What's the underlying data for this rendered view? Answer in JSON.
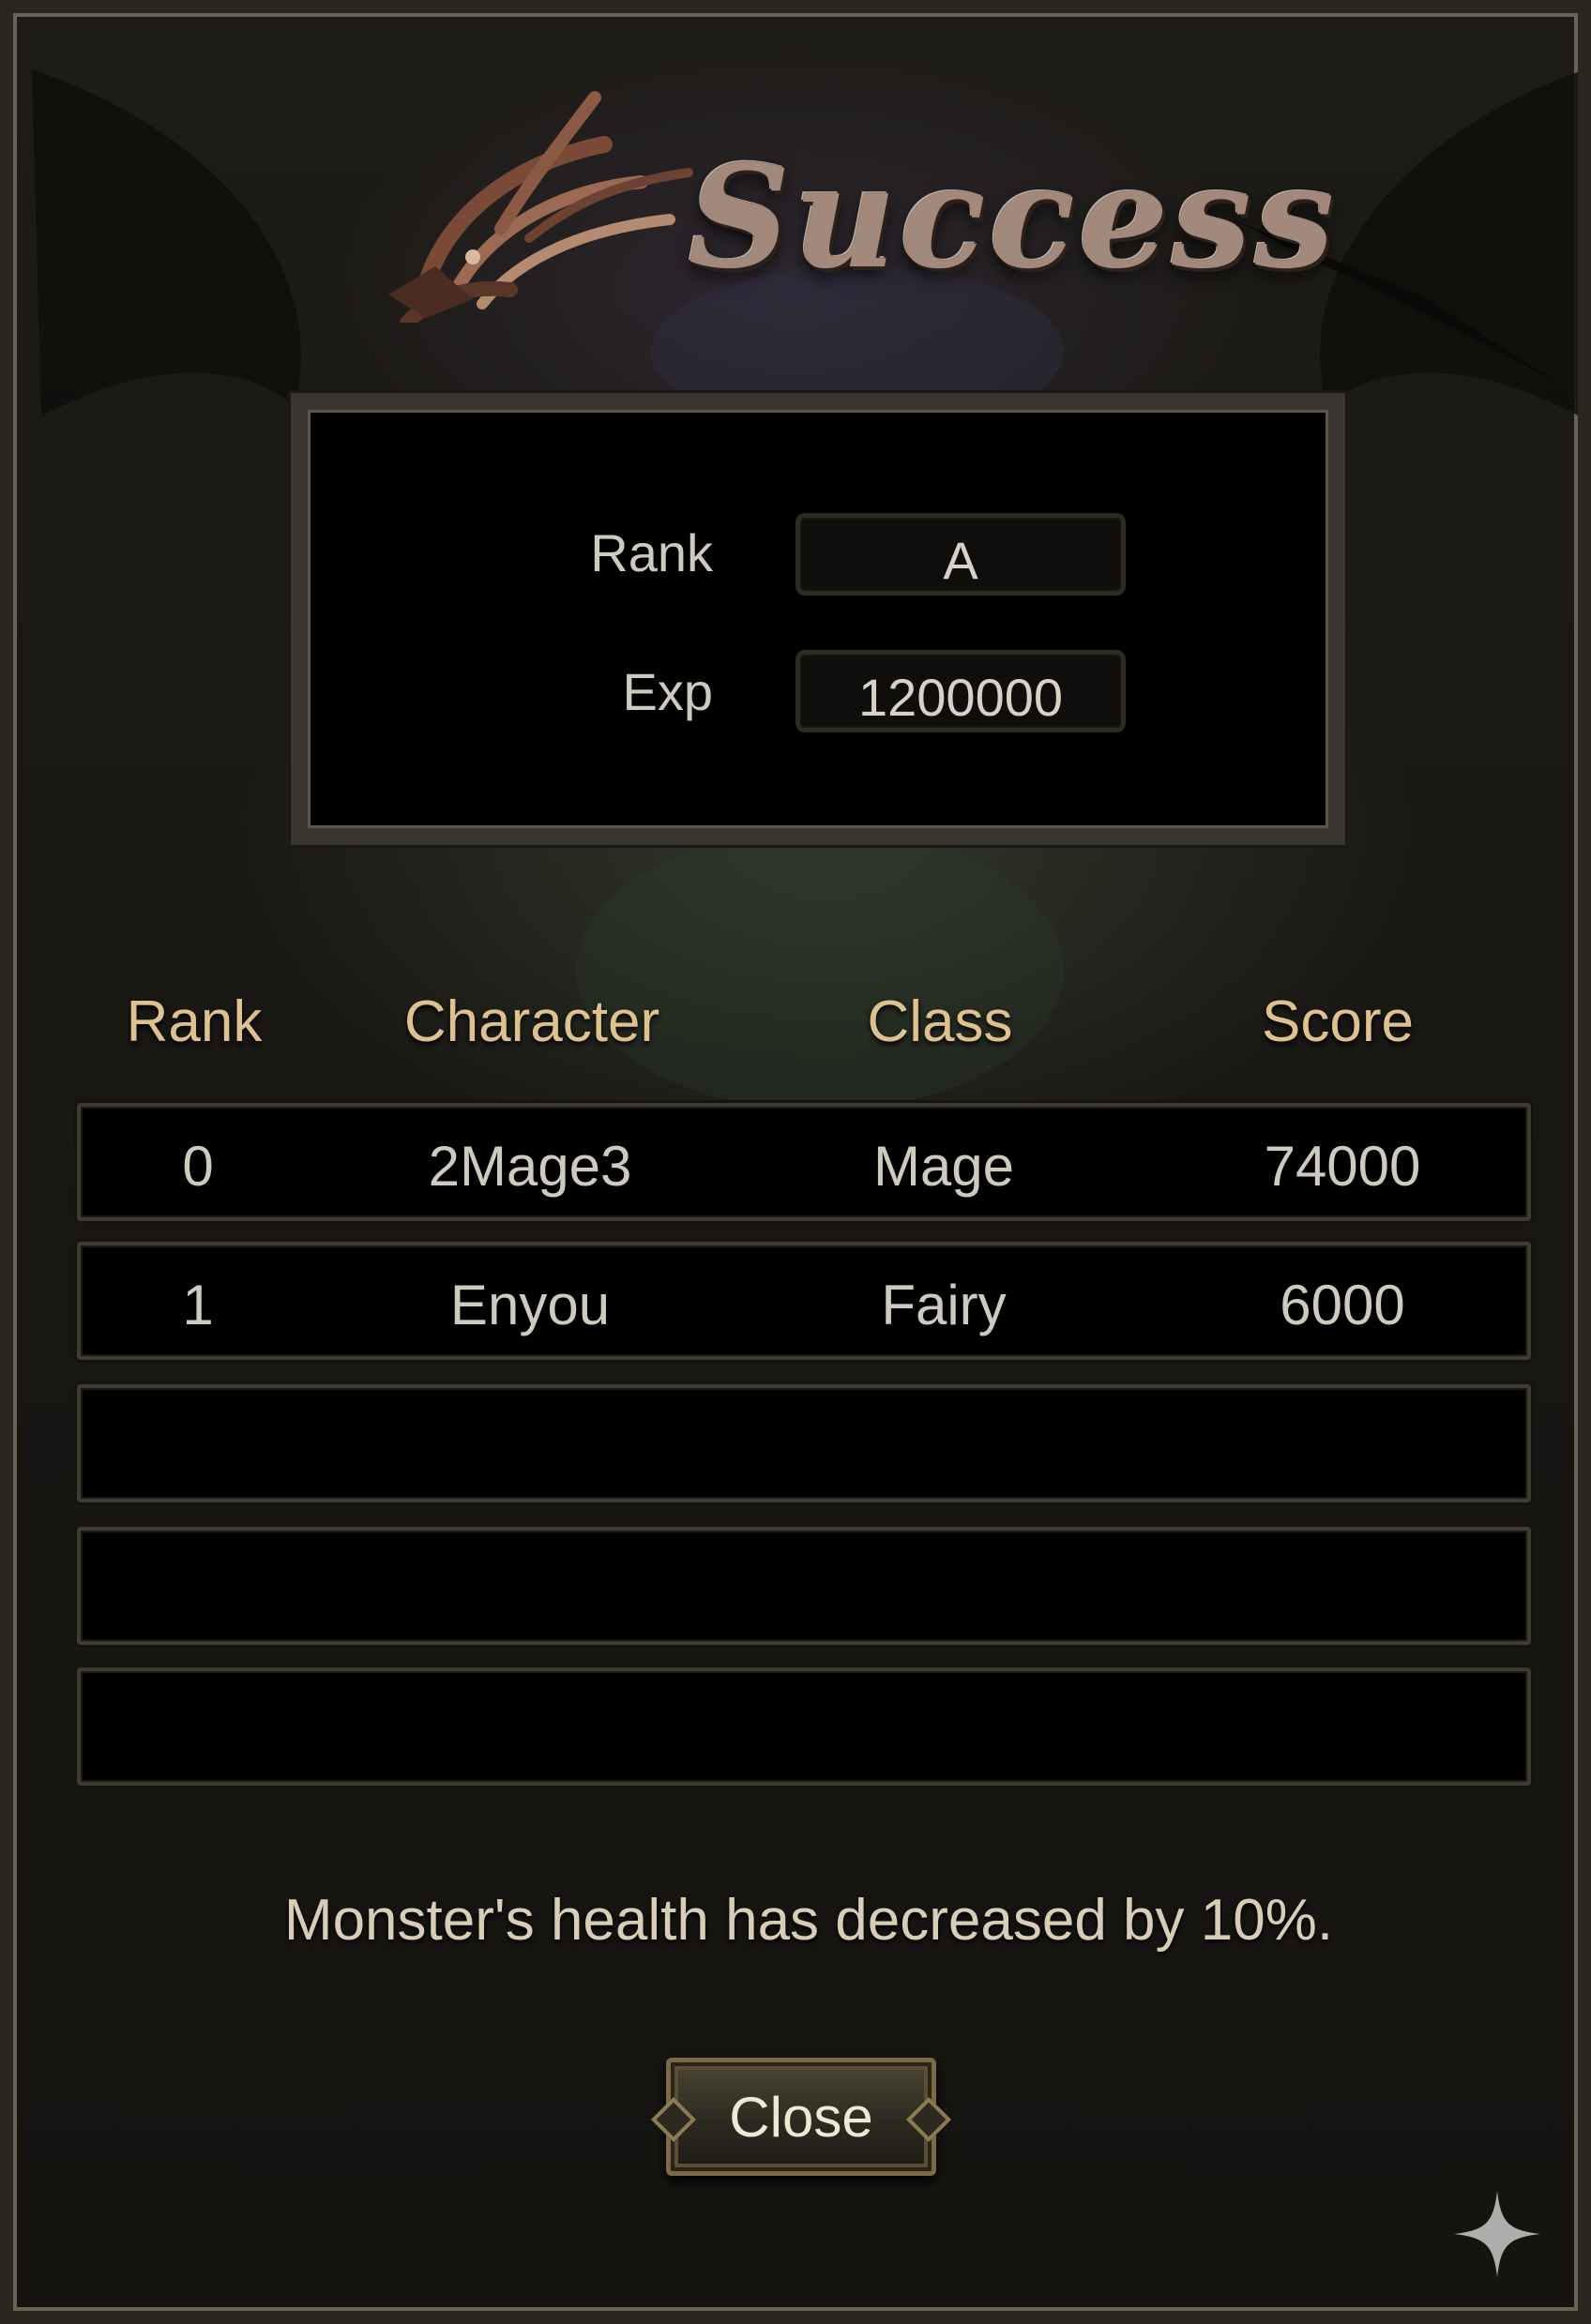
{
  "header": {
    "title": "Success",
    "emblem": "wolf-emblem"
  },
  "summary": {
    "rank_label": "Rank",
    "rank_value": "A",
    "exp_label": "Exp",
    "exp_value": "1200000"
  },
  "table": {
    "headers": [
      "Rank",
      "Character",
      "Class",
      "Score"
    ],
    "rows": [
      [
        "0",
        "2Mage3",
        "Mage",
        "74000"
      ],
      [
        "1",
        "Enyou",
        "Fairy",
        "6000"
      ],
      [
        "",
        "",
        "",
        ""
      ],
      [
        "",
        "",
        "",
        ""
      ],
      [
        "",
        "",
        "",
        ""
      ]
    ]
  },
  "message": "Monster's health has decreased by 10%.",
  "close_label": "Close",
  "colors": {
    "header_gold": "#ddc28f",
    "text_light": "#cfcac0",
    "title_copper": "#a2897b"
  },
  "icons": {
    "corner": "sparkle-icon"
  }
}
